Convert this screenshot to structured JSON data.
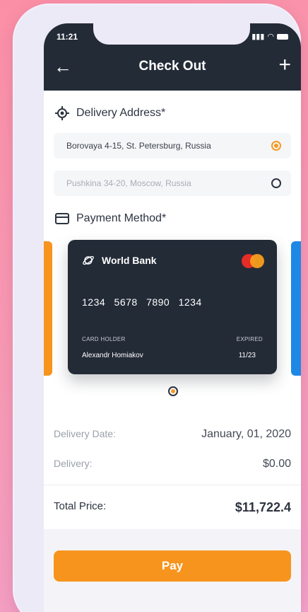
{
  "status": {
    "time": "11:21"
  },
  "header": {
    "title": "Check Out"
  },
  "delivery": {
    "title": "Delivery Address*",
    "addresses": [
      {
        "text": "Borovaya 4-15, St. Petersburg, Russia",
        "selected": true
      },
      {
        "text": "Pushkina 34-20, Moscow, Russia",
        "selected": false
      }
    ]
  },
  "payment": {
    "title": "Payment Method*",
    "card": {
      "bank": "World Bank",
      "number": "1234 5678 7890 1234",
      "holder_label": "CARD HOLDER",
      "holder": "Alexandr Homiakov",
      "expired_label": "EXPIRED",
      "expired": "11/23"
    }
  },
  "summary": {
    "delivery_date_label": "Delivery Date:",
    "delivery_date": "January, 01, 2020",
    "delivery_label": "Delivery:",
    "delivery_cost": "$0.00",
    "total_label": "Total Price:",
    "total": "$11,722.4"
  },
  "pay_label": "Pay",
  "colors": {
    "accent": "#f7941d",
    "dark": "#232b37",
    "blue": "#1e88e5"
  }
}
